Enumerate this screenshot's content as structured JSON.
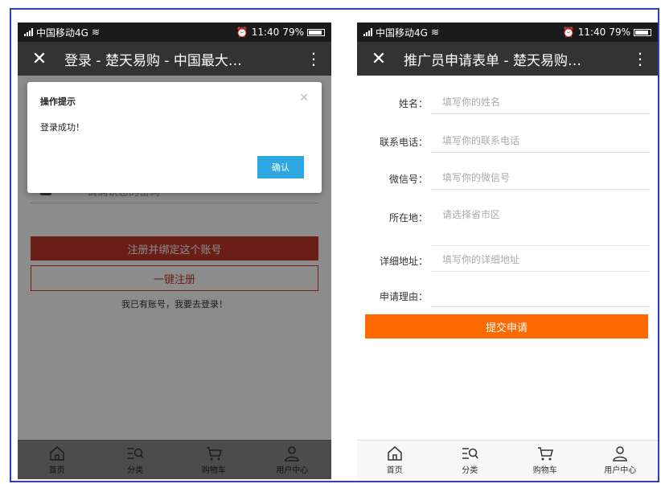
{
  "status": {
    "carrier": "中国移动4G",
    "time": "11:40",
    "battery": "79%"
  },
  "left": {
    "title": "登录 - 楚天易购 - 中国最大…",
    "password_placeholder": "请确认您的密码",
    "bind_button": "注册并绑定这个账号",
    "register_button": "一键注册",
    "hint": "我已有账号，我要去登录！",
    "dialog": {
      "title": "操作提示",
      "message": "登录成功！",
      "ok": "确认"
    }
  },
  "right": {
    "title": "推广员申请表单 - 楚天易购…",
    "fields": [
      {
        "label": "姓名：",
        "placeholder": "填写你的姓名"
      },
      {
        "label": "联系电话：",
        "placeholder": "填写你的联系电话"
      },
      {
        "label": "微信号：",
        "placeholder": "填写你的微信号"
      },
      {
        "label": "所在地：",
        "placeholder": "请选择省市区"
      },
      {
        "label": "详细地址：",
        "placeholder": "填写你的详细地址"
      },
      {
        "label": "申请理由：",
        "placeholder": ""
      }
    ],
    "submit": "提交申请"
  },
  "tabs": [
    {
      "label": "首页",
      "icon": "home-icon"
    },
    {
      "label": "分类",
      "icon": "category-search-icon"
    },
    {
      "label": "购物车",
      "icon": "cart-icon"
    },
    {
      "label": "用户中心",
      "icon": "user-icon"
    }
  ],
  "colors": {
    "titlebar": "#333333",
    "bind_red": "#c0392b",
    "confirm_blue": "#2ea7e0",
    "submit_orange": "#ff6a00"
  }
}
